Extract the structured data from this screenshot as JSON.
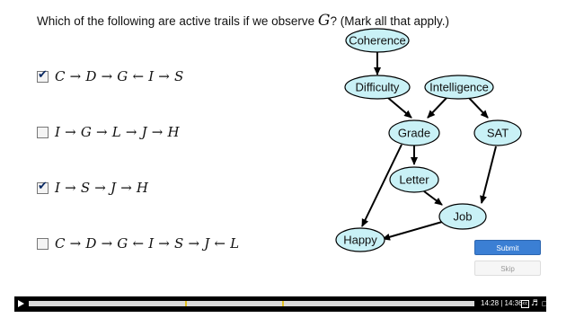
{
  "question": {
    "prefix": "Which of the following are active trails if we observe",
    "variable": "G",
    "suffix": "? (Mark all that apply.)"
  },
  "options": [
    {
      "text": "C → D → G ← I → S",
      "checked": true
    },
    {
      "text": "I → G → L → J → H",
      "checked": false
    },
    {
      "text": "I → S → J → H",
      "checked": true
    },
    {
      "text": "C → D → G ← I → S → J ← L",
      "checked": false
    }
  ],
  "diagram": {
    "fill_color": "#c9f1f6",
    "nodes": {
      "coherence": "Coherence",
      "difficulty": "Difficulty",
      "intelligence": "Intelligence",
      "grade": "Grade",
      "sat": "SAT",
      "letter": "Letter",
      "job": "Job",
      "happy": "Happy"
    }
  },
  "buttons": {
    "submit": "Submit",
    "skip": "Skip"
  },
  "player": {
    "time": "14:28 | 14:36",
    "cc_label": "cc",
    "icons": [
      "play-icon",
      "closed-captions-icon",
      "volume-icon",
      "expand-icon",
      "fullscreen-icon"
    ],
    "progress": 0.99
  }
}
